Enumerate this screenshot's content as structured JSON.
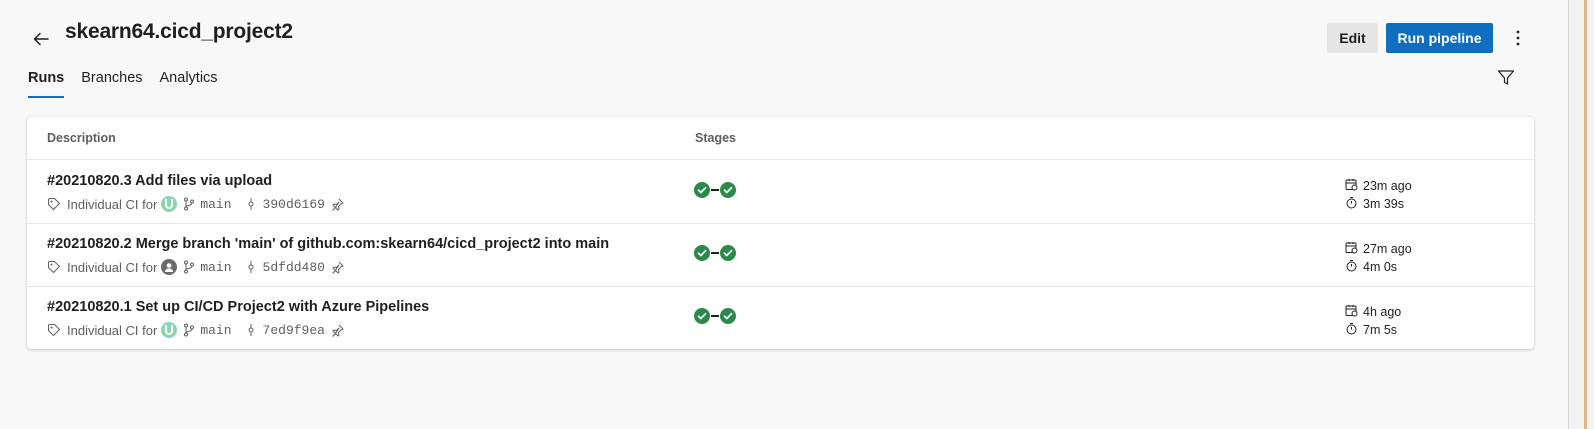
{
  "header": {
    "title": "skearn64.cicd_project2",
    "edit_label": "Edit",
    "run_label": "Run pipeline"
  },
  "tabs": [
    {
      "label": "Runs",
      "active": true
    },
    {
      "label": "Branches",
      "active": false
    },
    {
      "label": "Analytics",
      "active": false
    }
  ],
  "table": {
    "columns": {
      "description": "Description",
      "stages": "Stages"
    },
    "rows": [
      {
        "title": "#20210820.3 Add files via upload",
        "trigger": "Individual CI for",
        "avatar": "green",
        "branch": "main",
        "commit": "390d6169",
        "queued": "23m ago",
        "duration": "3m 39s",
        "stages": [
          "succeeded",
          "succeeded"
        ]
      },
      {
        "title": "#20210820.2 Merge branch 'main' of github.com:skearn64/cicd_project2 into main",
        "trigger": "Individual CI for",
        "avatar": "grey",
        "branch": "main",
        "commit": "5dfdd480",
        "queued": "27m ago",
        "duration": "4m 0s",
        "stages": [
          "succeeded",
          "succeeded"
        ]
      },
      {
        "title": "#20210820.1 Set up CI/CD Project2 with Azure Pipelines",
        "trigger": "Individual CI for",
        "avatar": "green",
        "branch": "main",
        "commit": "7ed9f9ea",
        "queued": "4h ago",
        "duration": "7m 5s",
        "stages": [
          "succeeded",
          "succeeded"
        ]
      }
    ]
  },
  "colors": {
    "primary": "#106ebe",
    "success": "#2b8a4b",
    "background": "#f8f8f8"
  }
}
